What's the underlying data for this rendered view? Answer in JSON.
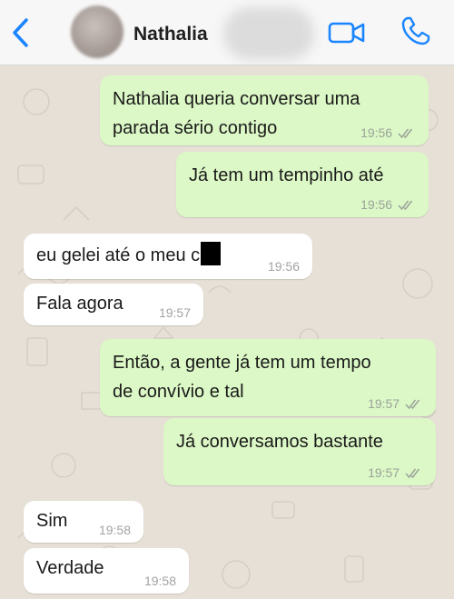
{
  "header": {
    "contact_name": "Nathalia",
    "icons": {
      "back": "chevron-left-icon",
      "video": "video-camera-icon",
      "call": "phone-icon"
    },
    "accent_color": "#1a85ff"
  },
  "messages": [
    {
      "direction": "outgoing",
      "lines": [
        "Nathalia queria conversar uma",
        "parada sério contigo"
      ],
      "time": "19:56",
      "read": true
    },
    {
      "direction": "outgoing",
      "lines": [
        "Já tem um tempinho até"
      ],
      "time": "19:56",
      "read": true
    },
    {
      "direction": "incoming",
      "lines": [
        "eu gelei até o meu c"
      ],
      "time": "19:56",
      "censored": true
    },
    {
      "direction": "incoming",
      "lines": [
        "Fala agora"
      ],
      "time": "19:57"
    },
    {
      "direction": "outgoing",
      "lines": [
        "Então, a gente já tem um tempo",
        "de convívio e tal"
      ],
      "time": "19:57",
      "read": true
    },
    {
      "direction": "outgoing",
      "lines": [
        "Já conversamos bastante"
      ],
      "time": "19:57",
      "read": true
    },
    {
      "direction": "incoming",
      "lines": [
        "Sim"
      ],
      "time": "19:58"
    },
    {
      "direction": "incoming",
      "lines": [
        "Verdade"
      ],
      "time": "19:58"
    }
  ],
  "colors": {
    "outgoing_bubble": "#dcf8c6",
    "incoming_bubble": "#ffffff",
    "chat_background": "#e6e0d6"
  }
}
